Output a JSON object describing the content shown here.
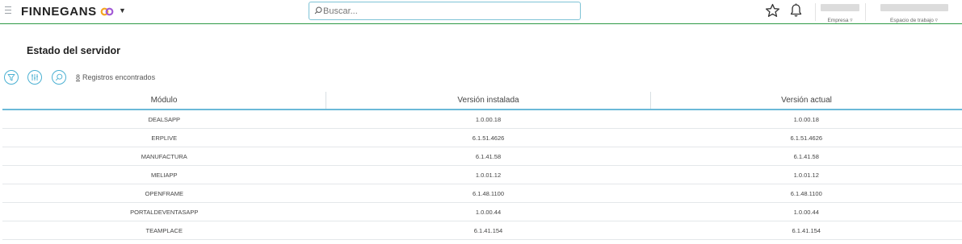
{
  "header": {
    "brand": "FINNEGANS",
    "search": {
      "placeholder": "Buscar..."
    },
    "empresa_label": "Empresa ▿",
    "espacio_label": "Espacio de trabajo ▿"
  },
  "page": {
    "title": "Estado del servidor",
    "record_count": "8",
    "record_count_label": "Registros encontrados"
  },
  "table": {
    "columns": [
      "Módulo",
      "Versión instalada",
      "Versión actual"
    ],
    "rows": [
      [
        "DEALSAPP",
        "1.0.00.18",
        "1.0.00.18"
      ],
      [
        "ERPLIVE",
        "6.1.51.4626",
        "6.1.51.4626"
      ],
      [
        "MANUFACTURA",
        "6.1.41.58",
        "6.1.41.58"
      ],
      [
        "MELIAPP",
        "1.0.01.12",
        "1.0.01.12"
      ],
      [
        "OPENFRAME",
        "6.1.48.1100",
        "6.1.48.1100"
      ],
      [
        "PORTALDEVENTASAPP",
        "1.0.00.44",
        "1.0.00.44"
      ],
      [
        "TEAMPLACE",
        "6.1.41.154",
        "6.1.41.154"
      ]
    ]
  },
  "colors": {
    "accent": "#4ab0d2",
    "brand_green": "#2e9a46",
    "logo_orange": "#f5a623",
    "logo_purple": "#8e44ad"
  }
}
